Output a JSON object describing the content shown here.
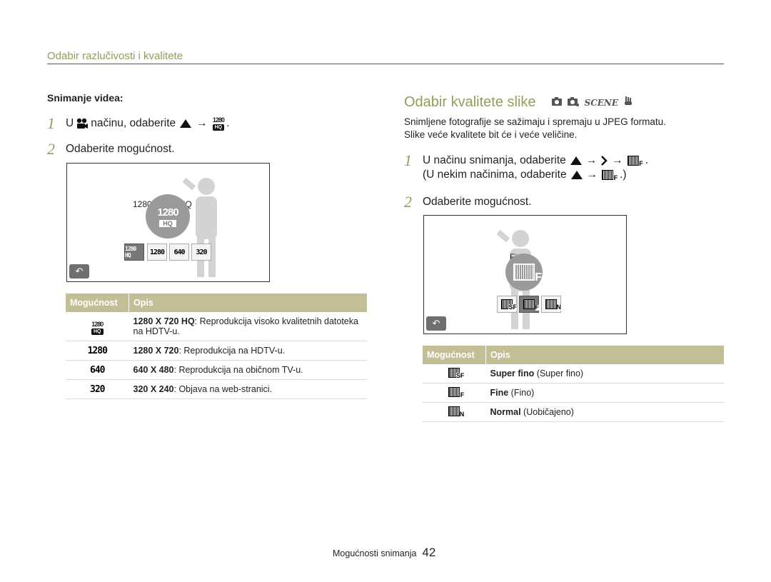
{
  "header": {
    "section_title": "Odabir razlučivosti i kvalitete"
  },
  "left": {
    "sub_heading": "Snimanje videa:",
    "step1": {
      "num": "1",
      "pre": "U",
      "mid": "načinu, odaberite",
      "arrow": "→",
      "end": "."
    },
    "step2": {
      "num": "2",
      "text": "Odaberite mogućnost."
    },
    "screen": {
      "caption": "1280 X 720 HQ",
      "big_icon_top": "1280",
      "big_icon_bottom": "HQ",
      "tiles": [
        "1280 HQ",
        "1280",
        "640",
        "320"
      ],
      "back_icon": "back-arrow-icon"
    },
    "table": {
      "headers": [
        "Mogućnost",
        "Opis"
      ],
      "rows": [
        {
          "icon": "1280",
          "icon_sub": "HQ",
          "bold": "1280 X 720 HQ",
          "rest": ": Reprodukcija visoko kvalitetnih datoteka na HDTV-u."
        },
        {
          "icon": "1280",
          "icon_sub": "",
          "bold": "1280 X 720",
          "rest": ": Reprodukcija na HDTV-u."
        },
        {
          "icon": "640",
          "icon_sub": "",
          "bold": "640 X 480",
          "rest": ": Reprodukcija na običnom TV-u."
        },
        {
          "icon": "320",
          "icon_sub": "",
          "bold": "320 X 240",
          "rest": ": Objava na web-stranici."
        }
      ]
    }
  },
  "right": {
    "title": "Odabir kvalitete slike",
    "mode_icons": [
      "camera-icon",
      "smart-camera-icon",
      "SCENE",
      "dual-is-icon"
    ],
    "scene_label": "SCENE",
    "intro_line1": "Snimljene fotografije se sažimaju i spremaju u JPEG formatu.",
    "intro_line2": "Slike veće kvalitete bit će i veće veličine.",
    "step1": {
      "num": "1",
      "text": "U načinu snimanja, odaberite",
      "arrow": "→",
      "end": "."
    },
    "step1b": {
      "text": "(U nekim načinima, odaberite",
      "arrow": "→",
      "end": ".)"
    },
    "step2": {
      "num": "2",
      "text": "Odaberite mogućnost."
    },
    "screen": {
      "caption": "Fine",
      "big_letter": "F",
      "tiles": [
        "SF",
        "F",
        "N"
      ],
      "back_icon": "back-arrow-icon"
    },
    "table": {
      "headers": [
        "Mogućnost",
        "Opis"
      ],
      "rows": [
        {
          "letter": "SF",
          "bold": "Super fino",
          "rest": " (Super fino)"
        },
        {
          "letter": "F",
          "bold": "Fine",
          "rest": " (Fino)"
        },
        {
          "letter": "N",
          "bold": "Normal",
          "rest": " (Uobičajeno)"
        }
      ]
    }
  },
  "footer": {
    "section": "Mogućnosti snimanja",
    "page": "42"
  }
}
